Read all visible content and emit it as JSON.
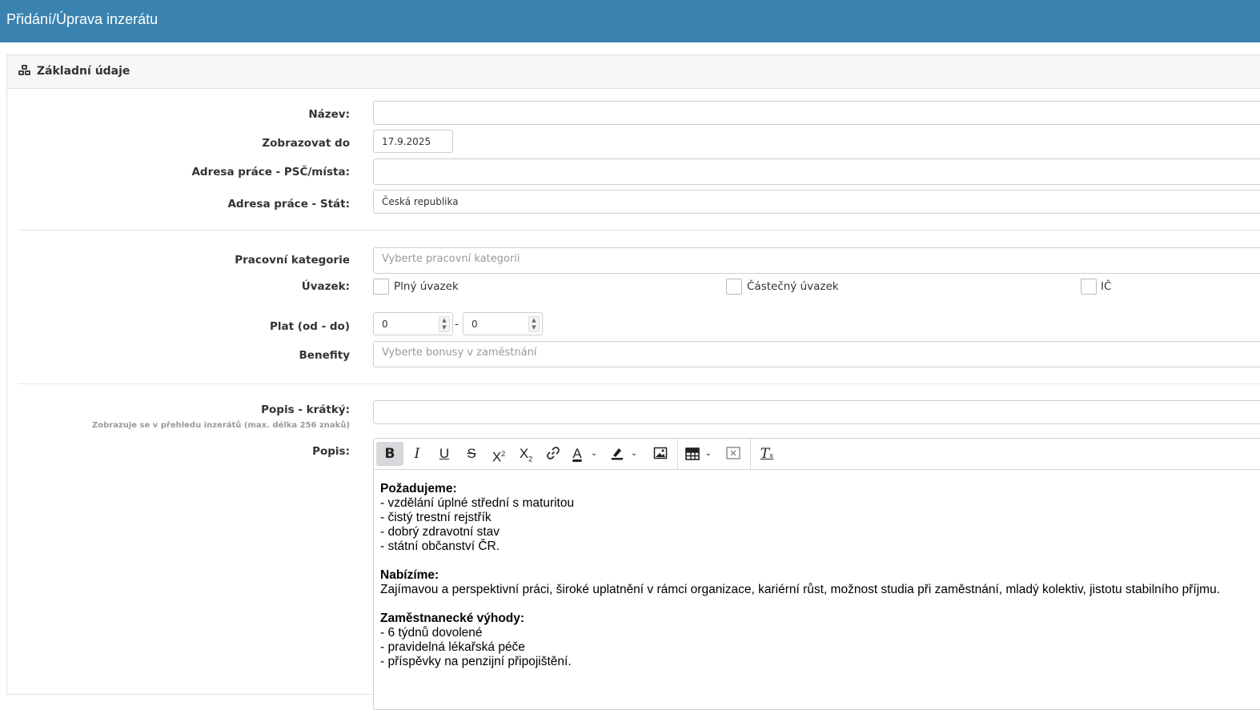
{
  "header": {
    "title": "Přidání/Úprava inzerátu"
  },
  "panel": {
    "title": "Základní údaje",
    "icon": "cubes-icon"
  },
  "fields": {
    "nazev": {
      "label": "Název:",
      "value": ""
    },
    "zobrazovat_do": {
      "label": "Zobrazovat do",
      "value": "17.9.2025"
    },
    "adresa_psc": {
      "label": "Adresa práce - PSČ/místa:",
      "value": ""
    },
    "adresa_stat": {
      "label": "Adresa práce - Stát:",
      "value": "Česká republika"
    },
    "kategorie": {
      "label": "Pracovní kategorie",
      "placeholder": "Vyberte pracovní kategorii"
    },
    "uvazek": {
      "label": "Úvazek:",
      "options": [
        "Plný úvazek",
        "Částečný úvazek",
        "IČ"
      ]
    },
    "plat": {
      "label": "Plat (od - do)",
      "from": "0",
      "to": "0",
      "separator": "-"
    },
    "benefity": {
      "label": "Benefity",
      "placeholder": "Vyberte bonusy v zaměstnání"
    },
    "popis_kratky": {
      "label": "Popis - krátký:",
      "hint": "Zobrazuje se v přehledu inzerátů (max. délka 256 znaků)",
      "value": ""
    },
    "popis": {
      "label": "Popis:"
    }
  },
  "editor": {
    "toolbar": [
      "bold-icon",
      "italic-icon",
      "underline-icon",
      "strikethrough-icon",
      "superscript-icon",
      "subscript-icon",
      "link-icon",
      "text-color-icon",
      "highlight-icon",
      "image-icon",
      "table-icon",
      "remove-icon",
      "clear-formatting-icon"
    ],
    "sections": [
      {
        "heading": "Požadujeme:",
        "lines": [
          "- vzdělání úplné střední s maturitou",
          "- čistý trestní rejstřík",
          "- dobrý zdravotní stav",
          "- státní občanství ČR."
        ]
      },
      {
        "heading": "Nabízíme:",
        "lines": [
          "Zajímavou a perspektivní práci, široké uplatnění v rámci organizace, kariérní růst, možnost studia při zaměstnání, mladý kolektiv, jistotu stabilního příjmu."
        ]
      },
      {
        "heading": "Zaměstnanecké výhody:",
        "lines": [
          "- 6 týdnů dovolené",
          "- pravidelná lékařská péče",
          "- příspěvky na penzijní připojištění."
        ]
      }
    ]
  }
}
